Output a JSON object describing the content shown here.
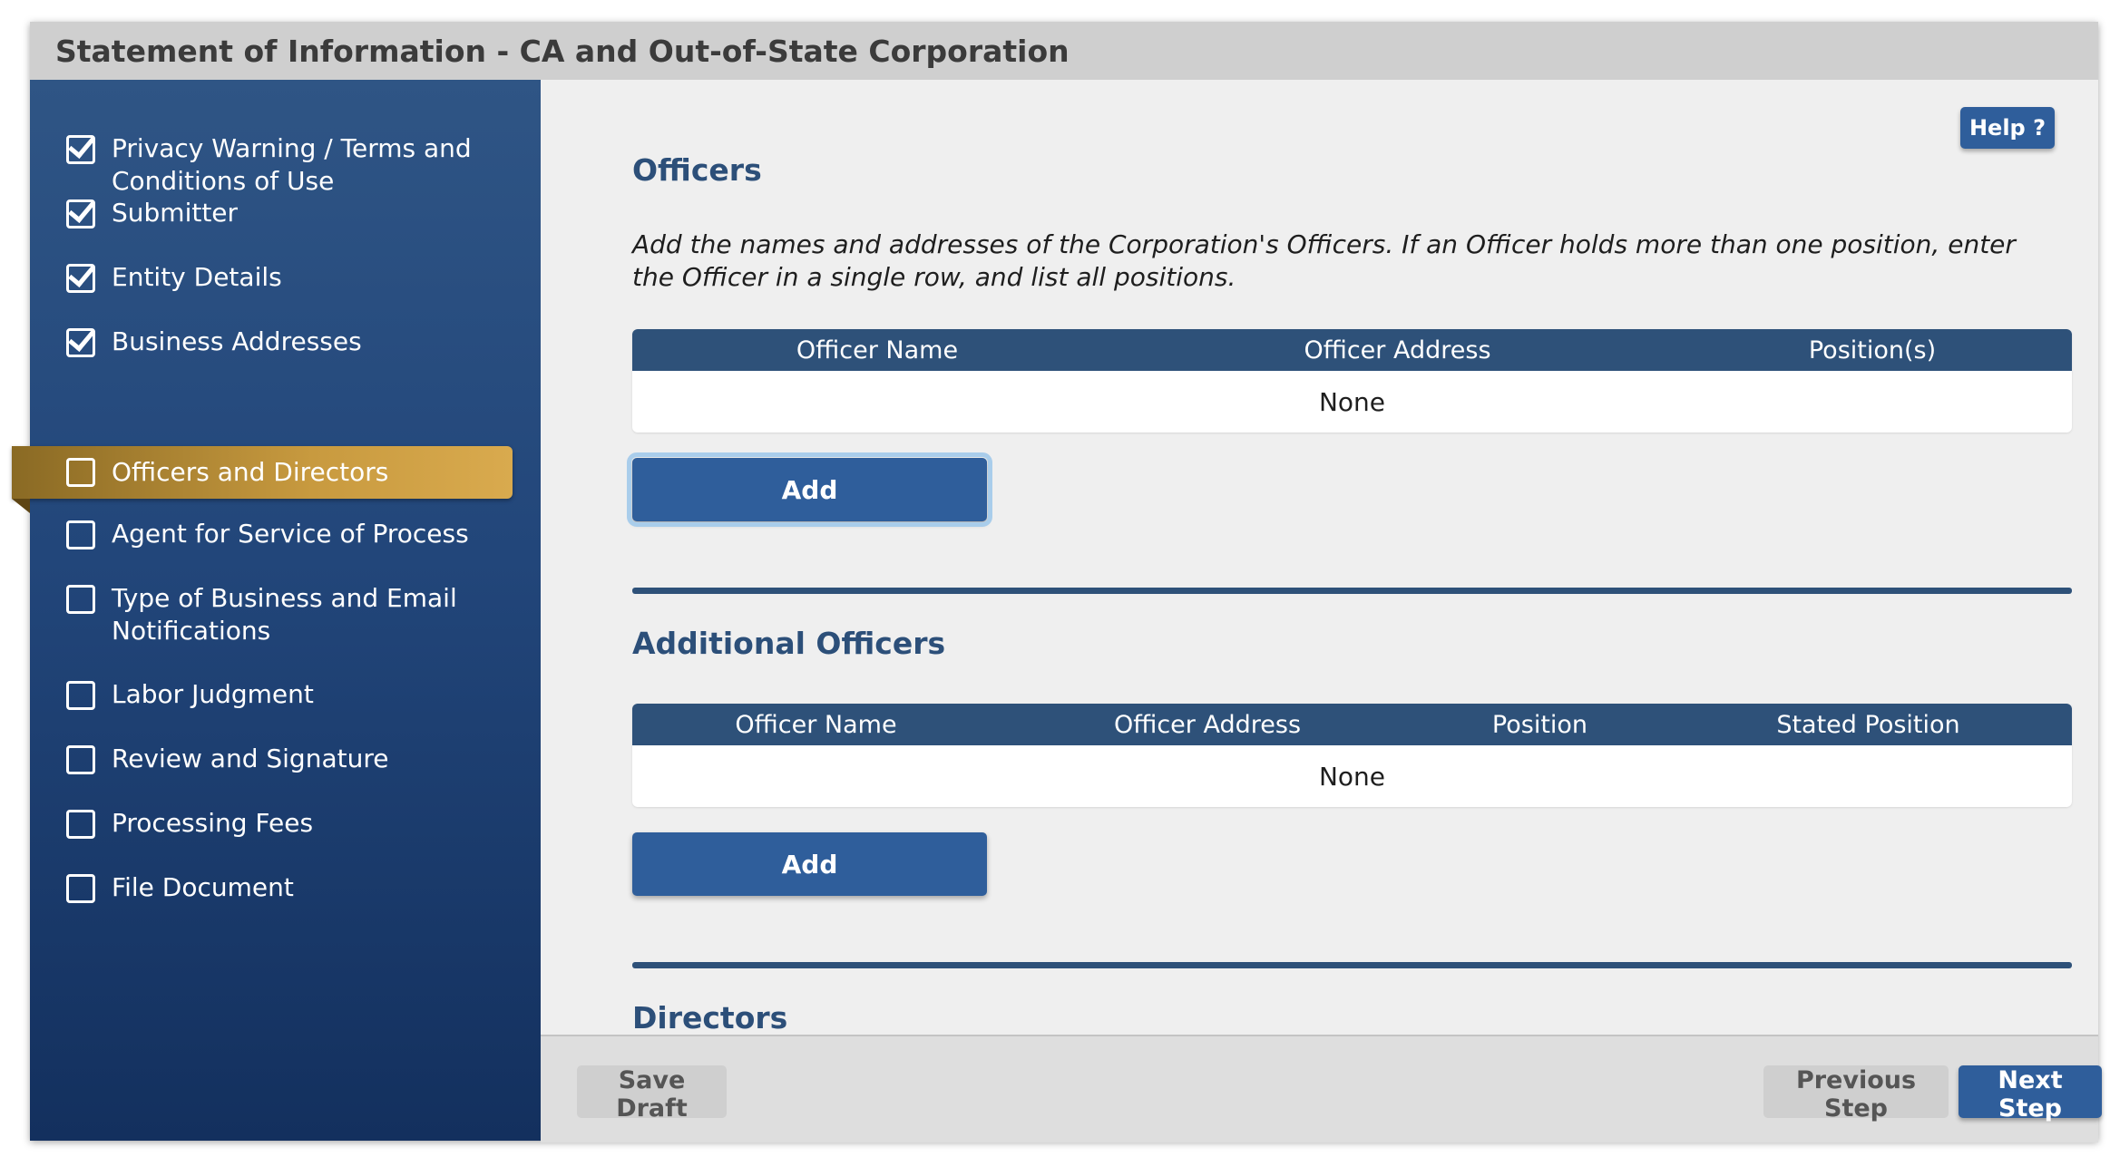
{
  "window": {
    "title": "Statement of Information - CA and Out-of-State Corporation"
  },
  "sidebar": {
    "items": [
      {
        "label": "Privacy Warning / Terms and Conditions of Use",
        "checked": true
      },
      {
        "label": "Submitter",
        "checked": true
      },
      {
        "label": "Entity Details",
        "checked": true
      },
      {
        "label": "Business Addresses",
        "checked": true
      },
      {
        "label": "Officers and Directors",
        "checked": false,
        "active": true
      },
      {
        "label": "Agent for Service of Process",
        "checked": false
      },
      {
        "label": "Type of Business and Email Notifications",
        "checked": false
      },
      {
        "label": "Labor Judgment",
        "checked": false
      },
      {
        "label": "Review and Signature",
        "checked": false
      },
      {
        "label": "Processing Fees",
        "checked": false
      },
      {
        "label": "File Document",
        "checked": false
      }
    ]
  },
  "main": {
    "help_label": "Help ?",
    "officers": {
      "title": "Officers",
      "description": "Add the names and addresses of the Corporation's Officers. If an Officer holds more than one position, enter the Officer in a single row, and list all positions.",
      "columns": [
        "Officer Name",
        "Officer Address",
        "Position(s)"
      ],
      "empty_text": "None",
      "add_label": "Add"
    },
    "additional_officers": {
      "title": "Additional Officers",
      "columns": [
        "Officer Name",
        "Officer Address",
        "Position",
        "Stated Position"
      ],
      "empty_text": "None",
      "add_label": "Add"
    },
    "directors": {
      "title": "Directors"
    }
  },
  "footer": {
    "save_draft_label": "Save Draft",
    "previous_label": "Previous Step",
    "next_label": "Next Step"
  },
  "colors": {
    "accent_blue": "#2f5e9b",
    "table_header": "#2e5179",
    "active_gold": "#c89a3f"
  }
}
